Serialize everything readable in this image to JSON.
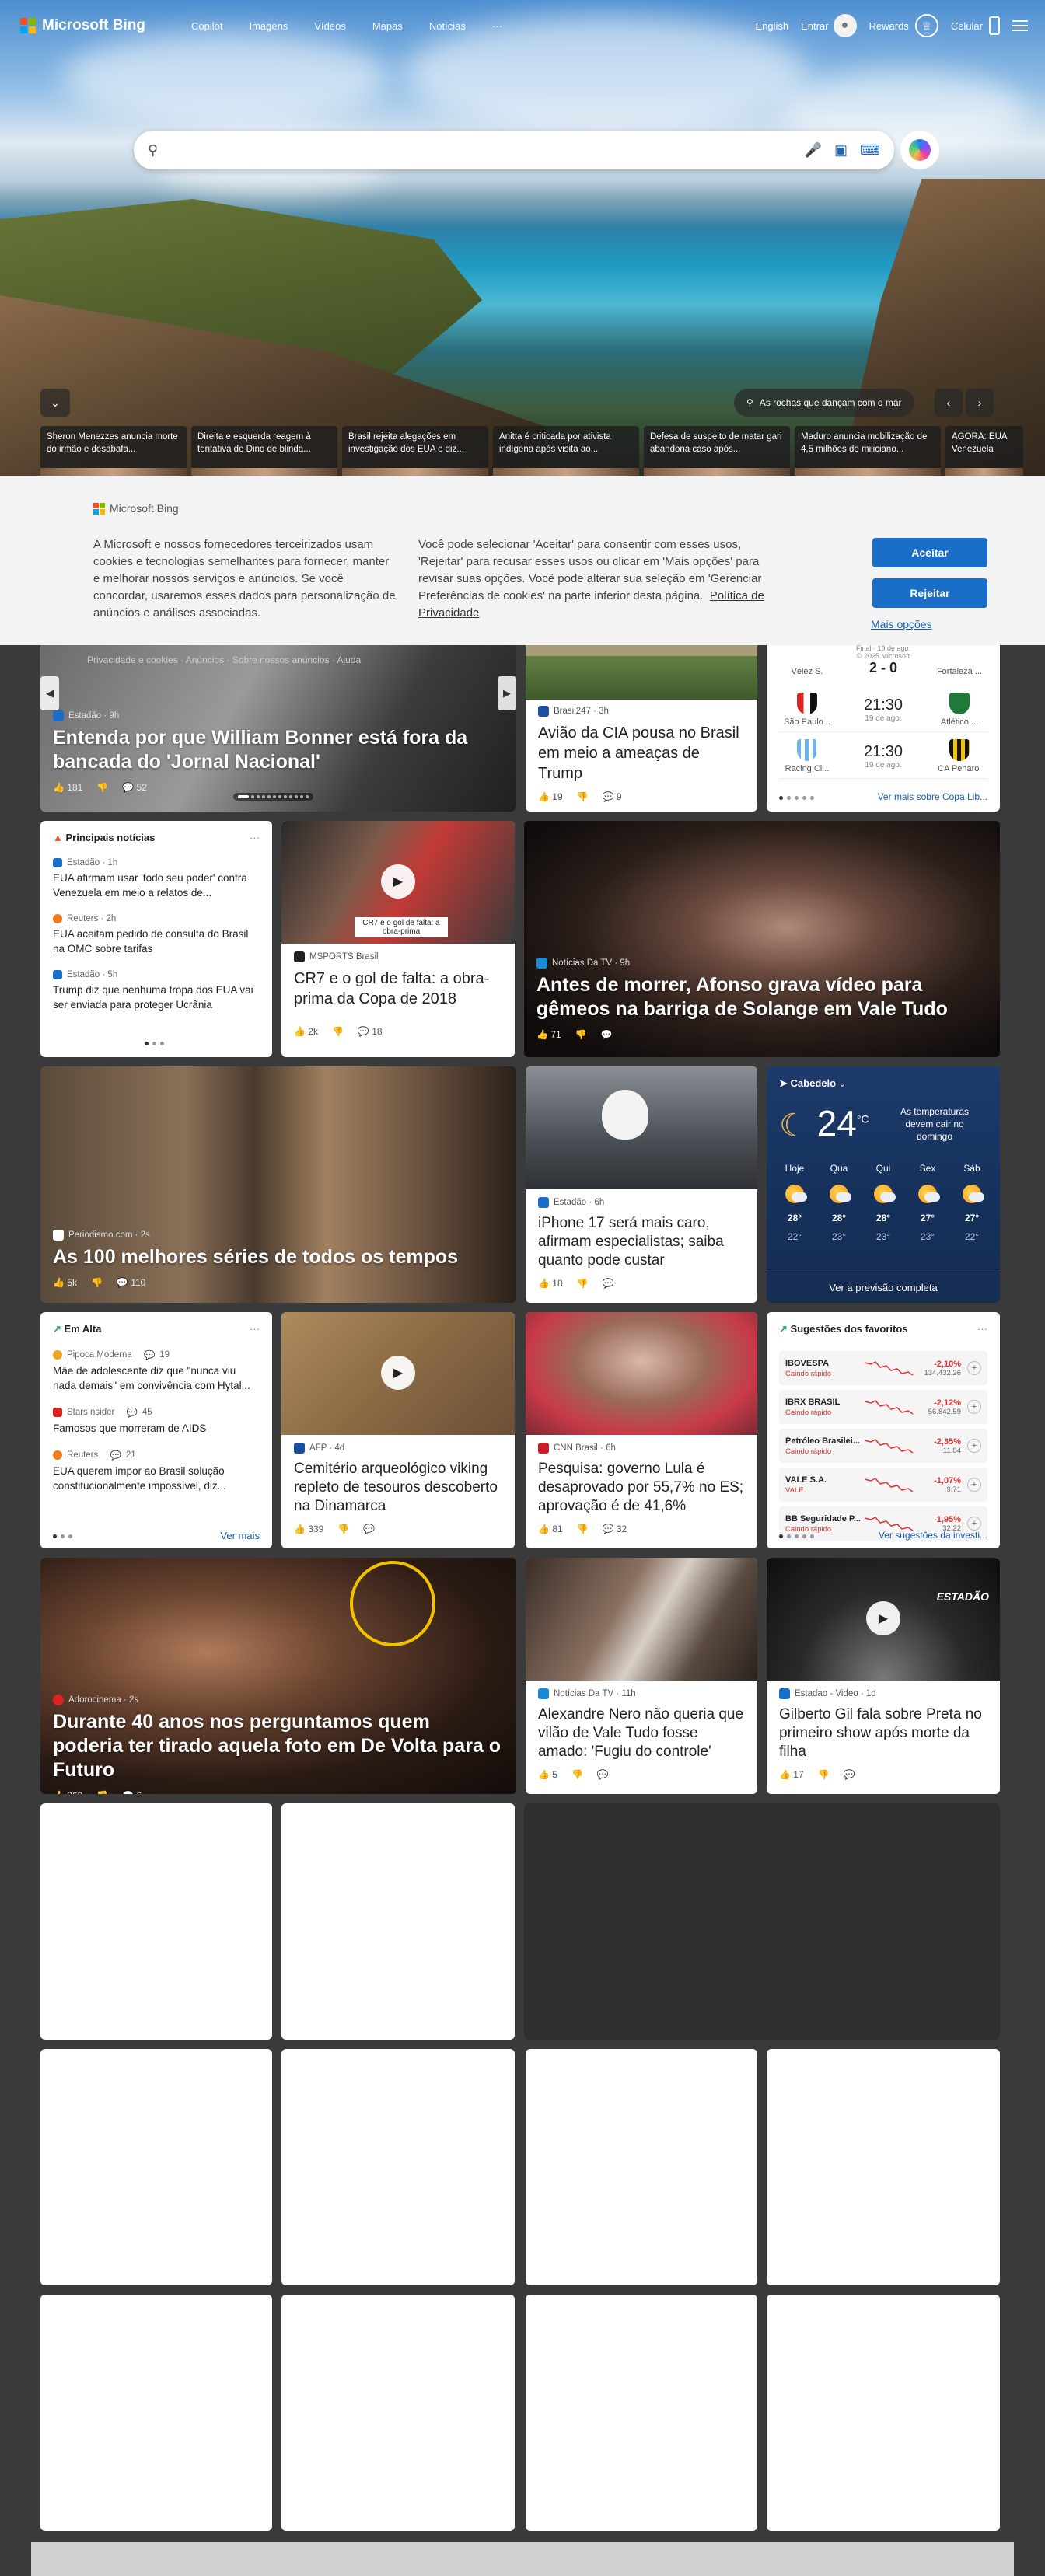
{
  "brand": {
    "name": "Microsoft Bing",
    "colors": [
      "#f25022",
      "#7fba00",
      "#00a4ef",
      "#ffb900"
    ]
  },
  "nav": {
    "items": [
      "Copilot",
      "Imagens",
      "Vídeos",
      "Mapas",
      "Notícias",
      "···"
    ]
  },
  "topbar": {
    "language": "English",
    "signin": "Entrar",
    "rewards": "Rewards",
    "phone": "Celular"
  },
  "search": {
    "value": "",
    "placeholder": ""
  },
  "hero": {
    "location": "As rochas que dançam com o mar",
    "ticker": [
      "Sheron Menezzes anuncia morte do irmão e desabafa...",
      "Direita e esquerda reagem à tentativa de Dino de blinda...",
      "Brasil rejeita alegações em investigação dos EUA e diz...",
      "Anitta é criticada por ativista indígena após visita ao...",
      "Defesa de suspeito de matar gari abandona caso após...",
      "Maduro anuncia mobilização de 4,5 milhões de miliciano...",
      "AGORA: EUA Venezuela"
    ]
  },
  "consent": {
    "brand": "Microsoft Bing",
    "text1": "A Microsoft e nossos fornecedores terceirizados usam cookies e tecnologias semelhantes para fornecer, manter e melhorar nossos serviços e anúncios. Se você concordar, usaremos esses dados para personalização de anúncios e análises associadas.",
    "text2": "Você pode selecionar 'Aceitar' para consentir com esses usos, 'Rejeitar' para recusar esses usos ou clicar em 'Mais opções' para revisar suas opções. Você pode alterar sua seleção em 'Gerenciar Preferências de cookies' na parte inferior desta página.",
    "privacy": "Política de Privacidade",
    "accept": "Aceitar",
    "reject": "Rejeitar",
    "more": "Mais opções",
    "behind": "Privacidade e cookies   ·   Anúncios   ·   Sobre nossos anúncios   ·   Ajuda",
    "copyright": "© 2025 Microsoft"
  },
  "row1": {
    "hero_card": {
      "source": "Estadão · 9h",
      "title": "Entenda por que William Bonner está fora da bancada do 'Jornal Nacional'",
      "likes": "181",
      "comments": "52"
    },
    "card2": {
      "source": "Brasil247 · 3h",
      "title": "Avião da CIA pousa no Brasil em meio a ameaças de Trump",
      "likes": "19",
      "comments": "9"
    },
    "sports": {
      "top": "Final · 19 de ago.",
      "top_teams": [
        "Vélez S.",
        "Fortaleza ..."
      ],
      "top_score": "2 - 0",
      "matches": [
        {
          "home": "São Paulo...",
          "away": "Atlético ...",
          "time": "21:30",
          "date": "19 de ago."
        },
        {
          "home": "Racing Cl...",
          "away": "CA Penarol",
          "time": "21:30",
          "date": "19 de ago."
        }
      ],
      "more": "Ver mais sobre Copa Lib..."
    }
  },
  "row2": {
    "top_news": {
      "header": "Principais notícias",
      "items": [
        {
          "source": "Estadão · 1h",
          "title": "EUA afirmam usar 'todo seu poder' contra Venezuela em meio a relatos de..."
        },
        {
          "source": "Reuters · 2h",
          "title": "EUA aceitam pedido de consulta do Brasil na OMC sobre tarifas"
        },
        {
          "source": "Estadão · 5h",
          "title": "Trump diz que nenhuma tropa dos EUA vai ser enviada para proteger Ucrânia"
        }
      ]
    },
    "cr7": {
      "source": "MSPORTS Brasil",
      "caption": "CR7 e o gol de falta: a obra-prima",
      "title": "CR7 e o gol de falta: a obra-prima da Copa de 2018",
      "likes": "2k",
      "comments": "18"
    },
    "afonso": {
      "source": "Notícias Da TV · 9h",
      "title": "Antes de morrer, Afonso grava vídeo para gêmeos na barriga de Solange em Vale Tudo",
      "likes": "71"
    }
  },
  "row3": {
    "series": {
      "source": "Periodismo.com · 2s",
      "title": "As 100 melhores séries de todos os tempos",
      "likes": "5k",
      "comments": "110"
    },
    "iphone": {
      "source": "Estadão · 6h",
      "title": "iPhone 17 será mais caro, afirmam especialistas; saiba quanto pode custar",
      "likes": "18"
    },
    "weather": {
      "location": "Cabedelo",
      "temp": "24",
      "unit": "°C",
      "note": "As temperaturas devem cair no domingo",
      "days": [
        {
          "d": "Hoje",
          "hi": "28°",
          "lo": "22°"
        },
        {
          "d": "Qua",
          "hi": "28°",
          "lo": "23°"
        },
        {
          "d": "Qui",
          "hi": "28°",
          "lo": "23°"
        },
        {
          "d": "Sex",
          "hi": "27°",
          "lo": "23°"
        },
        {
          "d": "Sáb",
          "hi": "27°",
          "lo": "22°"
        }
      ],
      "footer": "Ver a previsão completa"
    }
  },
  "row4": {
    "trending": {
      "header": "Em Alta",
      "items": [
        {
          "source": "Pipoca Moderna",
          "count": "19",
          "title": "Mãe de adolescente diz que \"nunca viu nada demais\" em convivência com Hytal..."
        },
        {
          "source": "StarsInsider",
          "count": "45",
          "title": "Famosos que morreram de AIDS"
        },
        {
          "source": "Reuters",
          "count": "21",
          "title": "EUA querem impor ao Brasil solução constitucionalmente impossível, diz..."
        }
      ],
      "more": "Ver mais"
    },
    "viking": {
      "source": "AFP · 4d",
      "title": "Cemitério arqueológico viking repleto de tesouros descoberto na Dinamarca",
      "likes": "339"
    },
    "lula": {
      "source": "CNN Brasil · 6h",
      "title": "Pesquisa: governo Lula é desaprovado por 55,7% no ES; aprovação é de 41,6%",
      "likes": "81",
      "comments": "32"
    },
    "stocks": {
      "header": "Sugestões dos favoritos",
      "items": [
        {
          "name": "IBOVESPA",
          "sub": "Caindo rápido",
          "pct": "-2,10%",
          "val": "134.432,26"
        },
        {
          "name": "IBRX BRASIL",
          "sub": "Caindo rápido",
          "pct": "-2,12%",
          "val": "56.842,59"
        },
        {
          "name": "Petróleo Brasilei...",
          "sub": "Caindo rápido",
          "pct": "-2,35%",
          "val": "11.84"
        },
        {
          "name": "VALE S.A.",
          "sub": "VALE",
          "pct": "-1,07%",
          "val": "9.71"
        },
        {
          "name": "BB Seguridade P...",
          "sub": "Caindo rápido",
          "pct": "-1,95%",
          "val": "32.22"
        }
      ],
      "more": "Ver sugestões da investi..."
    }
  },
  "row5": {
    "backfuture": {
      "source": "Adorocinema · 2s",
      "title": "Durante 40 anos nos perguntamos quem poderia ter tirado aquela foto em De Volta para o Futuro",
      "likes": "369",
      "comments": "6"
    },
    "nero": {
      "source": "Notícias Da TV · 11h",
      "title": "Alexandre Nero não queria que vilão de Vale Tudo fosse amado: 'Fugiu do controle'",
      "likes": "5"
    },
    "gil": {
      "source": "Estadao - Video · 1d",
      "badge": "ESTADÃO",
      "title": "Gilberto Gil fala sobre Preta no primeiro show após morte da filha",
      "likes": "17"
    }
  }
}
